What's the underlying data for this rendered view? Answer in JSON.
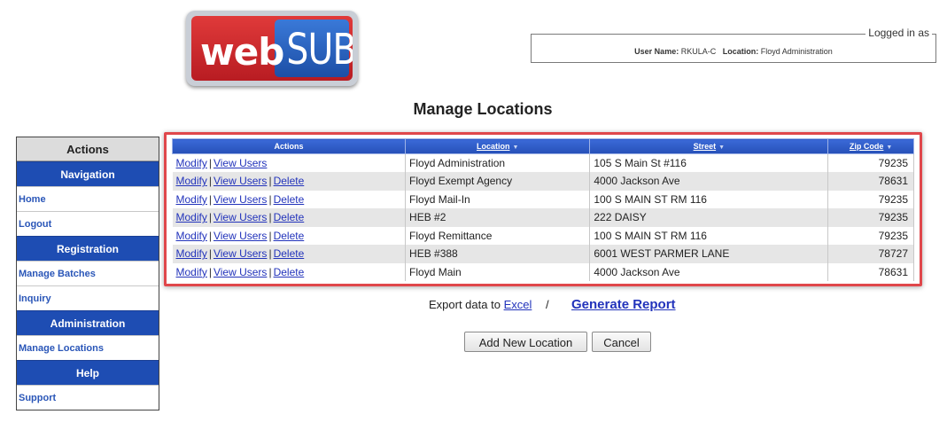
{
  "logo": {
    "left_text": "web",
    "right_text": "SUB"
  },
  "login": {
    "legend": "Logged in as",
    "user_label": "User Name:",
    "user_value": "RKULA-C",
    "location_label": "Location:",
    "location_value": "Floyd Administration"
  },
  "page_title": "Manage Locations",
  "sidebar": {
    "header": "Actions",
    "sections": [
      {
        "title": "Navigation",
        "items": [
          "Home",
          "Logout"
        ]
      },
      {
        "title": "Registration",
        "items": [
          "Manage Batches",
          "Inquiry"
        ]
      },
      {
        "title": "Administration",
        "items": [
          "Manage Locations"
        ]
      },
      {
        "title": "Help",
        "items": [
          "Support"
        ]
      }
    ]
  },
  "table": {
    "headers": {
      "actions": "Actions",
      "location": "Location",
      "street": "Street",
      "zip": "Zip Code"
    },
    "sort_icon": "sort-triangle-icon",
    "action_labels": {
      "modify": "Modify",
      "view_users": "View Users",
      "delete": "Delete"
    },
    "rows": [
      {
        "location": "Floyd Administration",
        "street": "105 S Main St #116",
        "zip": "79235",
        "deletable": false
      },
      {
        "location": "Floyd Exempt Agency",
        "street": "4000 Jackson Ave",
        "zip": "78631",
        "deletable": true
      },
      {
        "location": "Floyd Mail-In",
        "street": "100 S MAIN ST RM 116",
        "zip": "79235",
        "deletable": true
      },
      {
        "location": "HEB #2",
        "street": "222 DAISY",
        "zip": "79235",
        "deletable": true
      },
      {
        "location": "Floyd Remittance",
        "street": "100 S MAIN ST RM 116",
        "zip": "79235",
        "deletable": true
      },
      {
        "location": "HEB #388",
        "street": "6001 WEST PARMER LANE",
        "zip": "78727",
        "deletable": true
      },
      {
        "location": "Floyd Main",
        "street": "4000 Jackson Ave",
        "zip": "78631",
        "deletable": true
      }
    ]
  },
  "export": {
    "prefix": "Export data to",
    "excel_link": "Excel",
    "separator": "/"
  },
  "generate_report": "Generate Report",
  "buttons": {
    "add": "Add New Location",
    "cancel": "Cancel"
  },
  "colors": {
    "nav_blue": "#1e4db3",
    "highlight_red": "#e0474b",
    "link_blue": "#2233bb"
  }
}
